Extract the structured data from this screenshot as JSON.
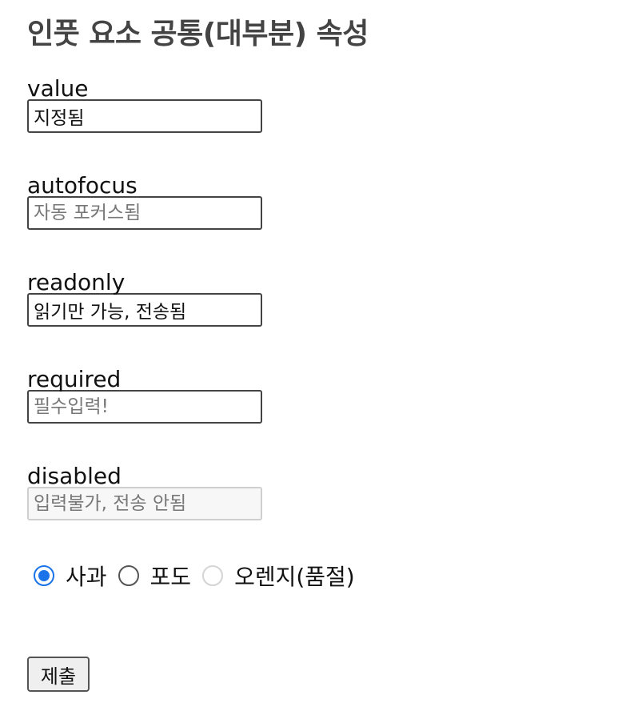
{
  "page": {
    "title": "인풋 요소 공통(대부분) 속성"
  },
  "fields": {
    "value": {
      "label": "value",
      "value": "지정됨",
      "placeholder": ""
    },
    "autofocus": {
      "label": "autofocus",
      "value": "",
      "placeholder": "자동 포커스됨"
    },
    "readonly": {
      "label": "readonly",
      "value": "읽기만 가능, 전송됨",
      "placeholder": ""
    },
    "required": {
      "label": "required",
      "value": "",
      "placeholder": "필수입력!"
    },
    "disabled": {
      "label": "disabled",
      "value": "",
      "placeholder": "입력불가, 전송 안됨"
    }
  },
  "radios": [
    {
      "label": "사과",
      "checked": true,
      "disabled": false
    },
    {
      "label": "포도",
      "checked": false,
      "disabled": false
    },
    {
      "label": "오렌지(품절)",
      "checked": false,
      "disabled": true
    }
  ],
  "submit": {
    "label": "제출"
  },
  "colors": {
    "accent": "#1a73e8",
    "title": "#444444"
  }
}
